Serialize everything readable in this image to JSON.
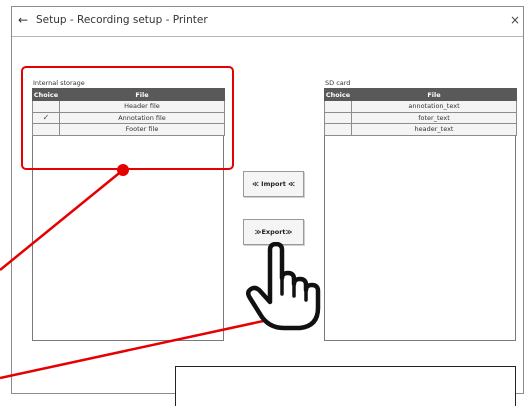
{
  "window": {
    "title": "Setup - Recording setup - Printer",
    "back_icon": "back-arrow-icon",
    "close_icon": "close-icon"
  },
  "internal_storage": {
    "label": "Internal storage",
    "columns": [
      "Choice",
      "File"
    ],
    "rows": [
      {
        "choice": "",
        "file": "Header file"
      },
      {
        "choice": "✓",
        "file": "Annotation file"
      },
      {
        "choice": "",
        "file": "Footer file"
      }
    ]
  },
  "sd_card": {
    "label": "SD card",
    "columns": [
      "Choice",
      "File"
    ],
    "rows": [
      {
        "choice": "",
        "file": "annotation_text"
      },
      {
        "choice": "",
        "file": "foter_text"
      },
      {
        "choice": "",
        "file": "header_text"
      }
    ]
  },
  "buttons": {
    "import_label": "≪ Import ≪",
    "export_label": "≫Export≫"
  },
  "annotations": {
    "highlight_color": "#e60000",
    "pointer_icon": "hand-pointer-icon"
  }
}
